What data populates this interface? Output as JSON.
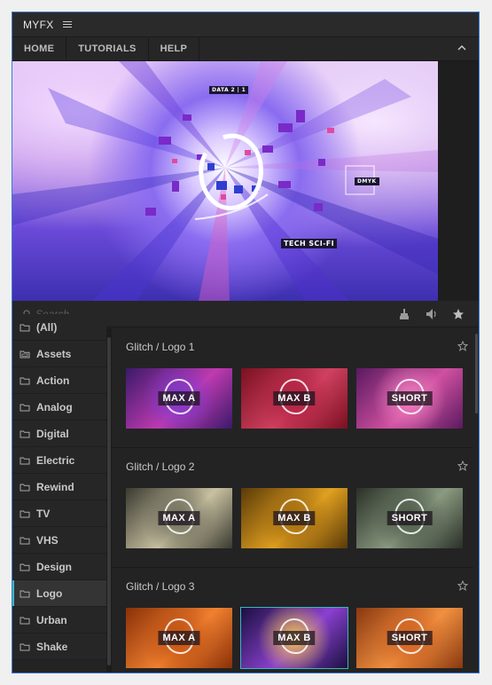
{
  "app": {
    "title": "MYFX"
  },
  "nav": {
    "items": [
      "HOME",
      "TUTORIALS",
      "HELP"
    ]
  },
  "preview": {
    "tags": {
      "top": "DATA 2 | 1",
      "corner": "DMYK",
      "bottom": "TECH SCI-FI"
    }
  },
  "search": {
    "placeholder": "Search"
  },
  "sidebar": {
    "items": [
      {
        "label": "(All)",
        "icon": "folder-icon"
      },
      {
        "label": "Assets",
        "icon": "folders-icon"
      },
      {
        "label": "Action",
        "icon": "folder-icon"
      },
      {
        "label": "Analog",
        "icon": "folder-icon"
      },
      {
        "label": "Digital",
        "icon": "folder-icon"
      },
      {
        "label": "Electric",
        "icon": "folder-icon"
      },
      {
        "label": "Rewind",
        "icon": "folder-icon"
      },
      {
        "label": "TV",
        "icon": "folder-icon"
      },
      {
        "label": "VHS",
        "icon": "folder-icon"
      },
      {
        "label": "Design",
        "icon": "folder-icon"
      },
      {
        "label": "Logo",
        "icon": "folder-icon",
        "active": true
      },
      {
        "label": "Urban",
        "icon": "folder-icon"
      },
      {
        "label": "Shake",
        "icon": "folder-icon"
      }
    ]
  },
  "groups": [
    {
      "title": "Glitch / Logo 1",
      "thumbs": [
        {
          "label": "MAX A",
          "colors": [
            "#3a1a6a",
            "#c03ab0",
            "#7a3ad0"
          ]
        },
        {
          "label": "MAX B",
          "colors": [
            "#7a1020",
            "#d04060",
            "#b02040"
          ]
        },
        {
          "label": "SHORT",
          "colors": [
            "#5a1a60",
            "#d050a0",
            "#f080c0"
          ]
        }
      ]
    },
    {
      "title": "Glitch / Logo 2",
      "thumbs": [
        {
          "label": "MAX A",
          "colors": [
            "#3a3a30",
            "#c8c0a0",
            "#6a6a58"
          ]
        },
        {
          "label": "MAX B",
          "colors": [
            "#5a3a08",
            "#e0a020",
            "#a06a10"
          ]
        },
        {
          "label": "SHORT",
          "colors": [
            "#2a3028",
            "#8a9a80",
            "#4a5848"
          ]
        }
      ]
    },
    {
      "title": "Glitch / Logo 3",
      "thumbs": [
        {
          "label": "MAX A",
          "colors": [
            "#8a3008",
            "#f08030",
            "#c05010"
          ]
        },
        {
          "label": "MAX B",
          "colors": [
            "#1a1040",
            "#8a40d0",
            "#f0c050"
          ],
          "selected": true
        },
        {
          "label": "SHORT",
          "colors": [
            "#8a3810",
            "#f09040",
            "#d06020"
          ]
        }
      ]
    }
  ],
  "colors": {
    "accent": "#38b6c6",
    "panel": "#232323",
    "border": "#3a7bd5"
  }
}
